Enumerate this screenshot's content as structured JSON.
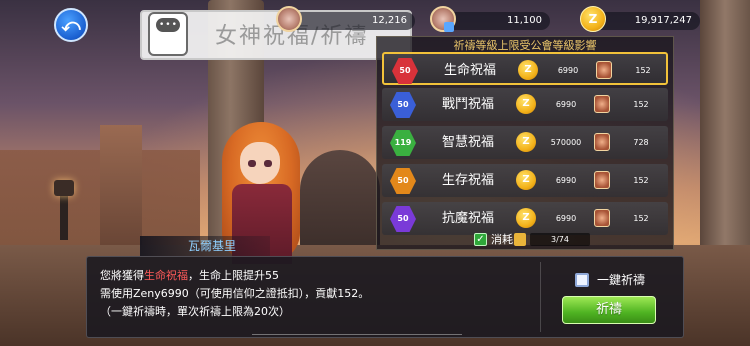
{
  "header": {
    "title": "女神祝福/祈禱",
    "back_icon": "back-arrow-icon",
    "currency": [
      {
        "icon": "medal-icon",
        "value": "12,216"
      },
      {
        "icon": "locked-medal-icon",
        "value": "11,100"
      },
      {
        "icon": "zeny-coin-icon",
        "value": "19,917,247"
      }
    ]
  },
  "blessings": {
    "header": "祈禱等級上限受公會等級影響",
    "rows": [
      {
        "level": "50",
        "name": "生命祝福",
        "cost": "6990",
        "contribution": "152",
        "color": "red",
        "selected": true
      },
      {
        "level": "50",
        "name": "戰鬥祝福",
        "cost": "6990",
        "contribution": "152",
        "color": "blue",
        "selected": false
      },
      {
        "level": "119",
        "name": "智慧祝福",
        "cost": "570000",
        "contribution": "728",
        "color": "green",
        "selected": false
      },
      {
        "level": "50",
        "name": "生存祝福",
        "cost": "6990",
        "contribution": "152",
        "color": "orange",
        "selected": false
      },
      {
        "level": "50",
        "name": "抗魔祝福",
        "cost": "6990",
        "contribution": "152",
        "color": "purple",
        "selected": false
      }
    ],
    "coin_symbol": "Z",
    "consume_label": "消耗",
    "consume_count": "3/74"
  },
  "dialog": {
    "npc_name": "瓦爾基里",
    "line1_pre": "您將獲得",
    "line1_highlight": "生命祝福",
    "line1_post": "，生命上限提升55",
    "line2": "需使用Zeny6990（可使用信仰之證抵扣），貢獻152。",
    "line3": "（一鍵祈禱時，單次祈禱上限為20次）",
    "auto_pray_label": "一鍵祈禱",
    "pray_button": "祈禱"
  }
}
